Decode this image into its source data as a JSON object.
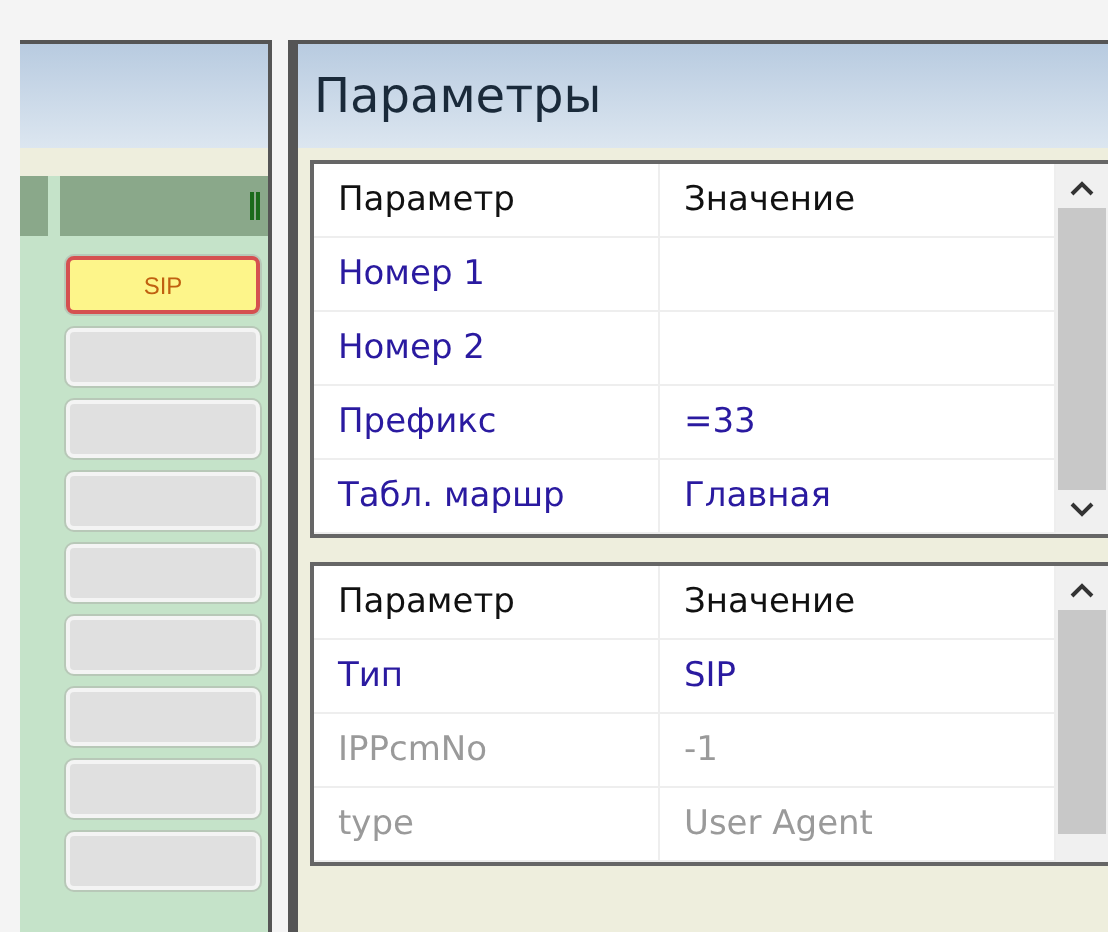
{
  "slots_panel": {
    "slots": [
      {
        "label": "SIP",
        "selected": true
      },
      {
        "selected": false
      },
      {
        "selected": false
      },
      {
        "selected": false
      },
      {
        "selected": false
      },
      {
        "selected": false
      },
      {
        "selected": false
      },
      {
        "selected": false
      },
      {
        "selected": false
      }
    ]
  },
  "parameters_panel": {
    "title": "Параметры",
    "tables": [
      {
        "columns": [
          "Параметр",
          "Значение"
        ],
        "rows": [
          {
            "name": "Номер 1",
            "disabled": false
          },
          {
            "name": "Номер 2",
            "disabled": false
          },
          {
            "name": "Префикс",
            "value": "=33",
            "disabled": false
          },
          {
            "name": "Табл. маршр",
            "value": "Главная",
            "disabled": false
          }
        ]
      },
      {
        "columns": [
          "Параметр",
          "Значение"
        ],
        "rows": [
          {
            "name": "Тип",
            "value": "SIP",
            "disabled": false
          },
          {
            "name": "IPPcmNo",
            "value": "-1",
            "disabled": true
          },
          {
            "name": "type",
            "value": "User Agent",
            "disabled": true
          }
        ]
      }
    ]
  }
}
